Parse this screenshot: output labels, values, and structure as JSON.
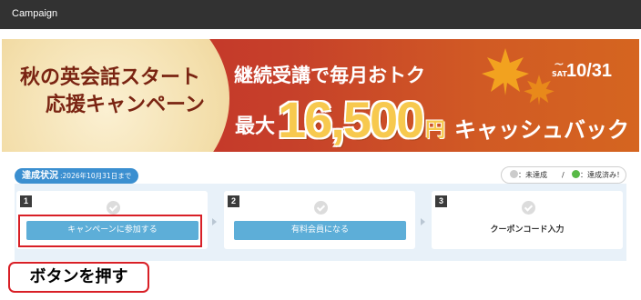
{
  "app": {
    "title": "Campaign"
  },
  "banner": {
    "headline_left_line1": "秋の英会話スタート",
    "headline_left_line2": "応援キャンペーン",
    "line1": "継続受講で毎月おトク",
    "max_label": "最大",
    "amount": "16,500",
    "yen": "円",
    "cashback": "キャッシュバック",
    "tilde": "~",
    "end_weekday": "SAT",
    "end_date": "10/31"
  },
  "status": {
    "label": "達成状況",
    "deadline": ":2026年10月31日まで"
  },
  "legend": {
    "not_achieved": "：未達成",
    "separator": "/",
    "achieved": "：達成済み！",
    "not_achieved_color": "#cccccc",
    "achieved_color": "#58b947"
  },
  "steps": [
    {
      "number": "1",
      "label": "キャンペーンに参加する",
      "type": "button",
      "status": "not-achieved"
    },
    {
      "number": "2",
      "label": "有料会員になる",
      "type": "button",
      "status": "not-achieved"
    },
    {
      "number": "3",
      "label": "クーポンコード入力",
      "type": "text",
      "status": "not-achieved"
    }
  ],
  "callout": {
    "text": "ボタンを押す"
  },
  "colors": {
    "topbar": "#323232",
    "accent_blue": "#3b8fd0",
    "button_blue": "#5daed8",
    "highlight_red": "#d81f26",
    "panel_bg": "#e8f1f9"
  }
}
